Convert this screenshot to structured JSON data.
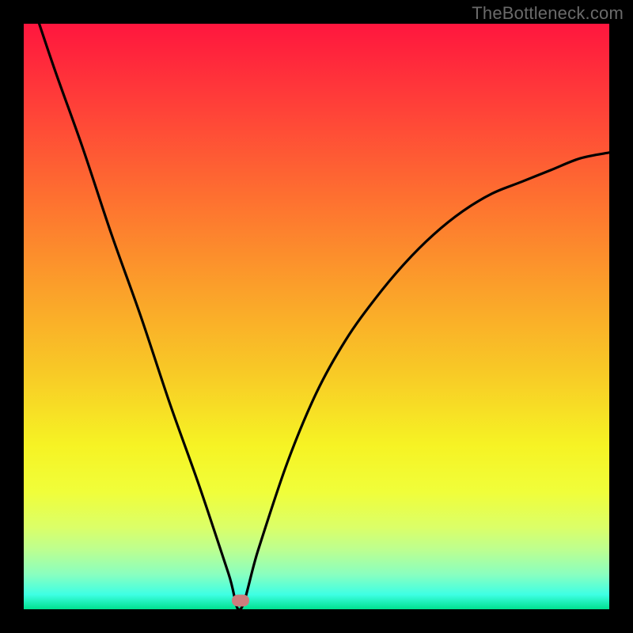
{
  "watermark": "TheBottleneck.com",
  "chart_data": {
    "type": "line",
    "title": "",
    "xlabel": "",
    "ylabel": "",
    "xlim": [
      0,
      100
    ],
    "ylim": [
      0,
      100
    ],
    "grid": false,
    "legend": false,
    "series": [
      {
        "name": "bottleneck-curve",
        "x": [
          0,
          5,
          10,
          15,
          20,
          25,
          30,
          35,
          37,
          40,
          45,
          50,
          55,
          60,
          65,
          70,
          75,
          80,
          85,
          90,
          95,
          100
        ],
        "y": [
          108,
          93,
          79,
          64,
          50,
          35,
          21,
          6,
          0,
          10,
          25,
          37,
          46,
          53,
          59,
          64,
          68,
          71,
          73,
          75,
          77,
          78
        ]
      }
    ],
    "marker": {
      "x": 37,
      "y": 1.5,
      "color": "#cc7d7d"
    },
    "gradient_stops": [
      {
        "pos": 0.0,
        "color": "#ff163e"
      },
      {
        "pos": 0.15,
        "color": "#ff4338"
      },
      {
        "pos": 0.3,
        "color": "#fe7130"
      },
      {
        "pos": 0.45,
        "color": "#fb9f2a"
      },
      {
        "pos": 0.6,
        "color": "#f8cb26"
      },
      {
        "pos": 0.72,
        "color": "#f6f324"
      },
      {
        "pos": 0.8,
        "color": "#f0fe3a"
      },
      {
        "pos": 0.86,
        "color": "#dbff68"
      },
      {
        "pos": 0.9,
        "color": "#bbff92"
      },
      {
        "pos": 0.94,
        "color": "#8affbf"
      },
      {
        "pos": 0.975,
        "color": "#3effe4"
      },
      {
        "pos": 1.0,
        "color": "#00e18f"
      }
    ]
  }
}
